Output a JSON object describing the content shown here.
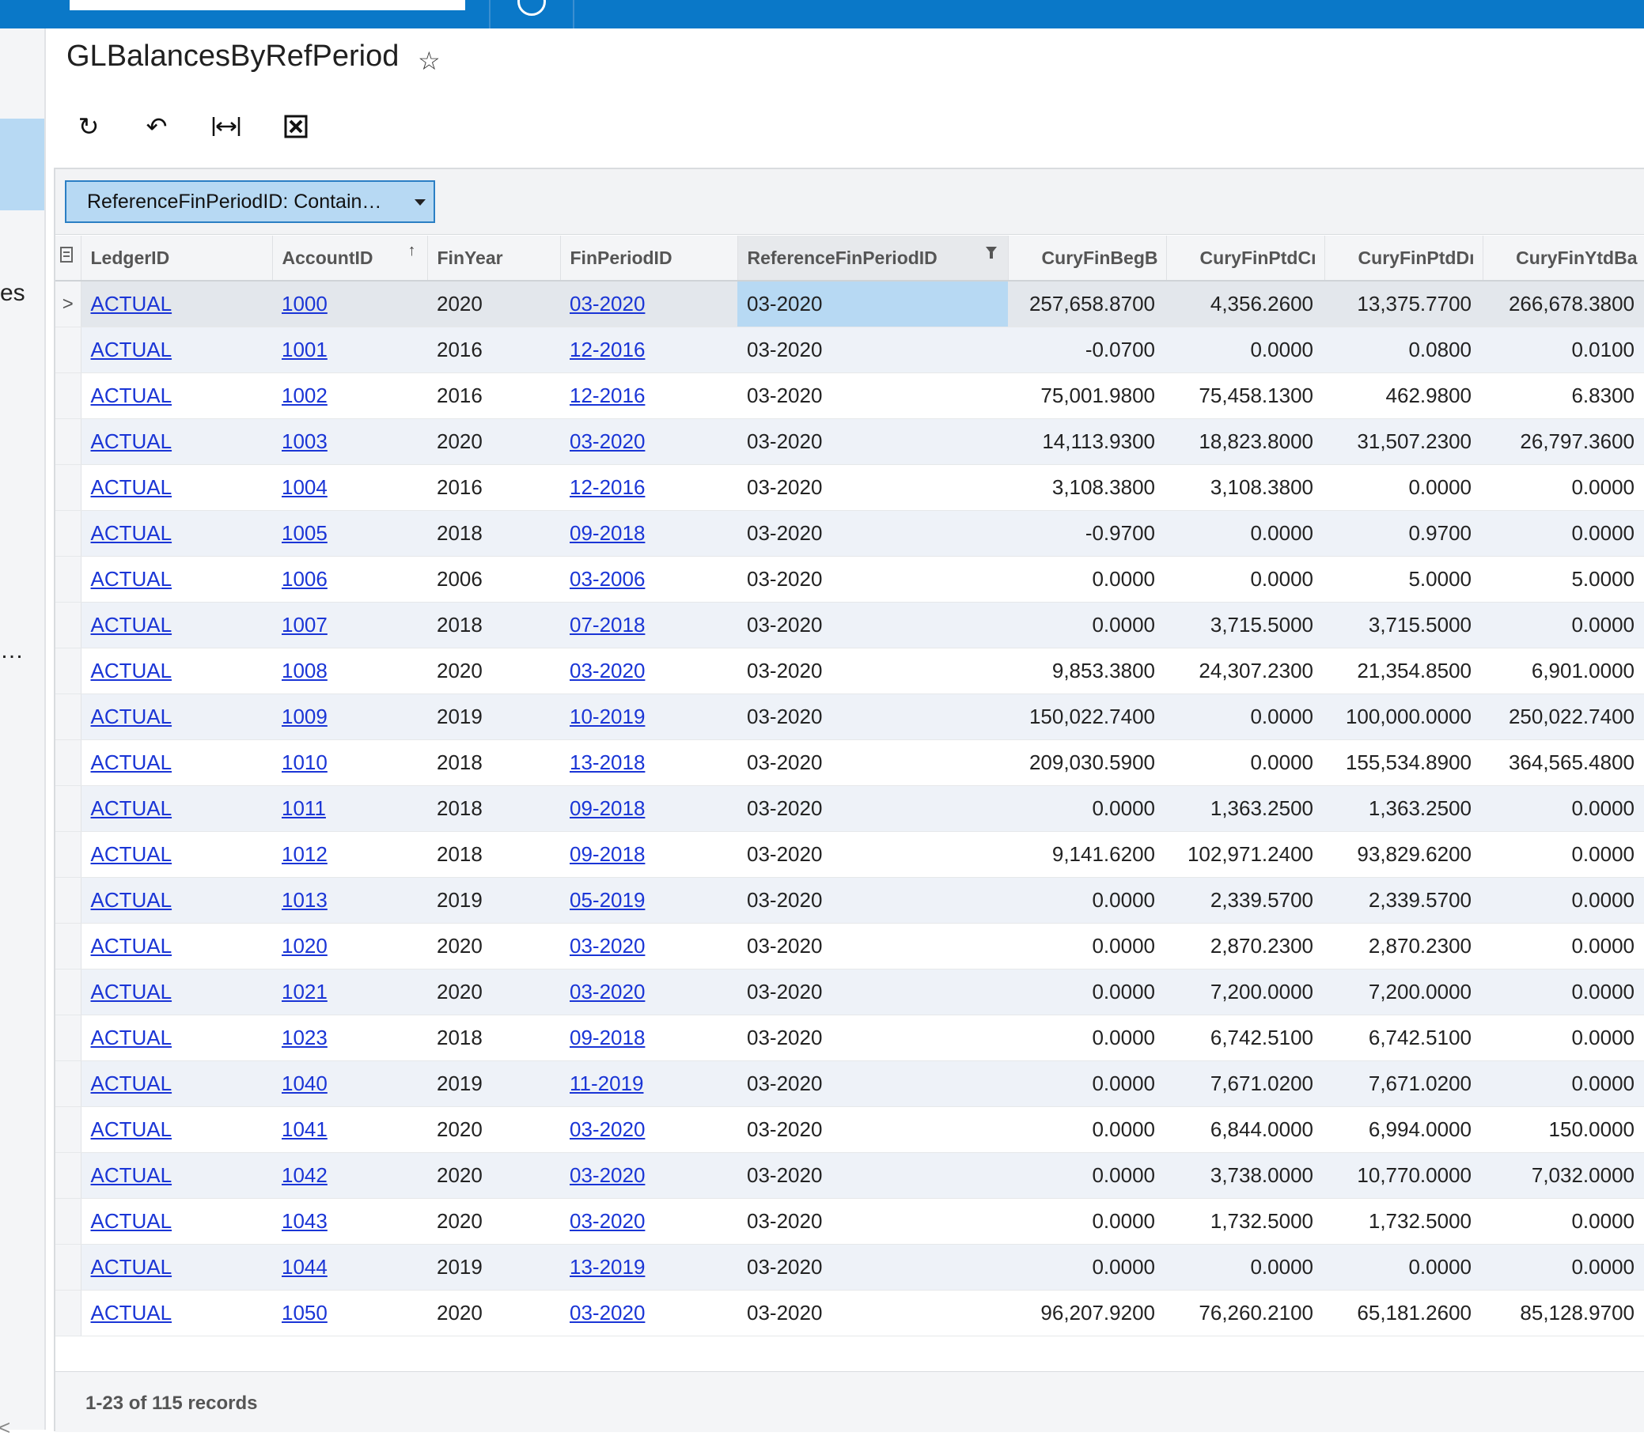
{
  "page": {
    "title": "GLBalancesByRefPeriod",
    "favorite_icon": "star-icon"
  },
  "left_sidebar": {
    "fragment_1": "es",
    "fragment_2": "…",
    "fragment_3": "<"
  },
  "toolbar": {
    "refresh_icon": "refresh-icon",
    "undo_icon": "undo-icon",
    "fit_columns_icon": "fit-columns-icon",
    "export_icon": "excel-export-icon"
  },
  "filter": {
    "label": "ReferenceFinPeriodID: Contain…"
  },
  "grid": {
    "columns": [
      "LedgerID",
      "AccountID",
      "FinYear",
      "FinPeriodID",
      "ReferenceFinPeriodID",
      "CuryFinBegB",
      "CuryFinPtdCı",
      "CuryFinPtdDı",
      "CuryFinYtdBa"
    ],
    "rows": [
      {
        "ledger": "ACTUAL",
        "account": "1000",
        "year": "2020",
        "period": "03-2020",
        "ref": "03-2020",
        "beg": "257,658.8700",
        "ptdcr": "4,356.2600",
        "ptddr": "13,375.7700",
        "ytd": "266,678.3800"
      },
      {
        "ledger": "ACTUAL",
        "account": "1001",
        "year": "2016",
        "period": "12-2016",
        "ref": "03-2020",
        "beg": "-0.0700",
        "ptdcr": "0.0000",
        "ptddr": "0.0800",
        "ytd": "0.0100"
      },
      {
        "ledger": "ACTUAL",
        "account": "1002",
        "year": "2016",
        "period": "12-2016",
        "ref": "03-2020",
        "beg": "75,001.9800",
        "ptdcr": "75,458.1300",
        "ptddr": "462.9800",
        "ytd": "6.8300"
      },
      {
        "ledger": "ACTUAL",
        "account": "1003",
        "year": "2020",
        "period": "03-2020",
        "ref": "03-2020",
        "beg": "14,113.9300",
        "ptdcr": "18,823.8000",
        "ptddr": "31,507.2300",
        "ytd": "26,797.3600"
      },
      {
        "ledger": "ACTUAL",
        "account": "1004",
        "year": "2016",
        "period": "12-2016",
        "ref": "03-2020",
        "beg": "3,108.3800",
        "ptdcr": "3,108.3800",
        "ptddr": "0.0000",
        "ytd": "0.0000"
      },
      {
        "ledger": "ACTUAL",
        "account": "1005",
        "year": "2018",
        "period": "09-2018",
        "ref": "03-2020",
        "beg": "-0.9700",
        "ptdcr": "0.0000",
        "ptddr": "0.9700",
        "ytd": "0.0000"
      },
      {
        "ledger": "ACTUAL",
        "account": "1006",
        "year": "2006",
        "period": "03-2006",
        "ref": "03-2020",
        "beg": "0.0000",
        "ptdcr": "0.0000",
        "ptddr": "5.0000",
        "ytd": "5.0000"
      },
      {
        "ledger": "ACTUAL",
        "account": "1007",
        "year": "2018",
        "period": "07-2018",
        "ref": "03-2020",
        "beg": "0.0000",
        "ptdcr": "3,715.5000",
        "ptddr": "3,715.5000",
        "ytd": "0.0000"
      },
      {
        "ledger": "ACTUAL",
        "account": "1008",
        "year": "2020",
        "period": "03-2020",
        "ref": "03-2020",
        "beg": "9,853.3800",
        "ptdcr": "24,307.2300",
        "ptddr": "21,354.8500",
        "ytd": "6,901.0000"
      },
      {
        "ledger": "ACTUAL",
        "account": "1009",
        "year": "2019",
        "period": "10-2019",
        "ref": "03-2020",
        "beg": "150,022.7400",
        "ptdcr": "0.0000",
        "ptddr": "100,000.0000",
        "ytd": "250,022.7400"
      },
      {
        "ledger": "ACTUAL",
        "account": "1010",
        "year": "2018",
        "period": "13-2018",
        "ref": "03-2020",
        "beg": "209,030.5900",
        "ptdcr": "0.0000",
        "ptddr": "155,534.8900",
        "ytd": "364,565.4800"
      },
      {
        "ledger": "ACTUAL",
        "account": "1011",
        "year": "2018",
        "period": "09-2018",
        "ref": "03-2020",
        "beg": "0.0000",
        "ptdcr": "1,363.2500",
        "ptddr": "1,363.2500",
        "ytd": "0.0000"
      },
      {
        "ledger": "ACTUAL",
        "account": "1012",
        "year": "2018",
        "period": "09-2018",
        "ref": "03-2020",
        "beg": "9,141.6200",
        "ptdcr": "102,971.2400",
        "ptddr": "93,829.6200",
        "ytd": "0.0000"
      },
      {
        "ledger": "ACTUAL",
        "account": "1013",
        "year": "2019",
        "period": "05-2019",
        "ref": "03-2020",
        "beg": "0.0000",
        "ptdcr": "2,339.5700",
        "ptddr": "2,339.5700",
        "ytd": "0.0000"
      },
      {
        "ledger": "ACTUAL",
        "account": "1020",
        "year": "2020",
        "period": "03-2020",
        "ref": "03-2020",
        "beg": "0.0000",
        "ptdcr": "2,870.2300",
        "ptddr": "2,870.2300",
        "ytd": "0.0000"
      },
      {
        "ledger": "ACTUAL",
        "account": "1021",
        "year": "2020",
        "period": "03-2020",
        "ref": "03-2020",
        "beg": "0.0000",
        "ptdcr": "7,200.0000",
        "ptddr": "7,200.0000",
        "ytd": "0.0000"
      },
      {
        "ledger": "ACTUAL",
        "account": "1023",
        "year": "2018",
        "period": "09-2018",
        "ref": "03-2020",
        "beg": "0.0000",
        "ptdcr": "6,742.5100",
        "ptddr": "6,742.5100",
        "ytd": "0.0000"
      },
      {
        "ledger": "ACTUAL",
        "account": "1040",
        "year": "2019",
        "period": "11-2019",
        "ref": "03-2020",
        "beg": "0.0000",
        "ptdcr": "7,671.0200",
        "ptddr": "7,671.0200",
        "ytd": "0.0000"
      },
      {
        "ledger": "ACTUAL",
        "account": "1041",
        "year": "2020",
        "period": "03-2020",
        "ref": "03-2020",
        "beg": "0.0000",
        "ptdcr": "6,844.0000",
        "ptddr": "6,994.0000",
        "ytd": "150.0000"
      },
      {
        "ledger": "ACTUAL",
        "account": "1042",
        "year": "2020",
        "period": "03-2020",
        "ref": "03-2020",
        "beg": "0.0000",
        "ptdcr": "3,738.0000",
        "ptddr": "10,770.0000",
        "ytd": "7,032.0000"
      },
      {
        "ledger": "ACTUAL",
        "account": "1043",
        "year": "2020",
        "period": "03-2020",
        "ref": "03-2020",
        "beg": "0.0000",
        "ptdcr": "1,732.5000",
        "ptddr": "1,732.5000",
        "ytd": "0.0000"
      },
      {
        "ledger": "ACTUAL",
        "account": "1044",
        "year": "2019",
        "period": "13-2019",
        "ref": "03-2020",
        "beg": "0.0000",
        "ptdcr": "0.0000",
        "ptddr": "0.0000",
        "ytd": "0.0000"
      },
      {
        "ledger": "ACTUAL",
        "account": "1050",
        "year": "2020",
        "period": "03-2020",
        "ref": "03-2020",
        "beg": "96,207.9200",
        "ptdcr": "76,260.2100",
        "ptddr": "65,181.2600",
        "ytd": "85,128.9700"
      }
    ],
    "active_row_indicator": ">"
  },
  "footer": {
    "records": "1-23 of 115 records"
  },
  "colors": {
    "topbar": "#0a78c8",
    "selection": "#b7d9f3",
    "link": "#1a35d6"
  }
}
